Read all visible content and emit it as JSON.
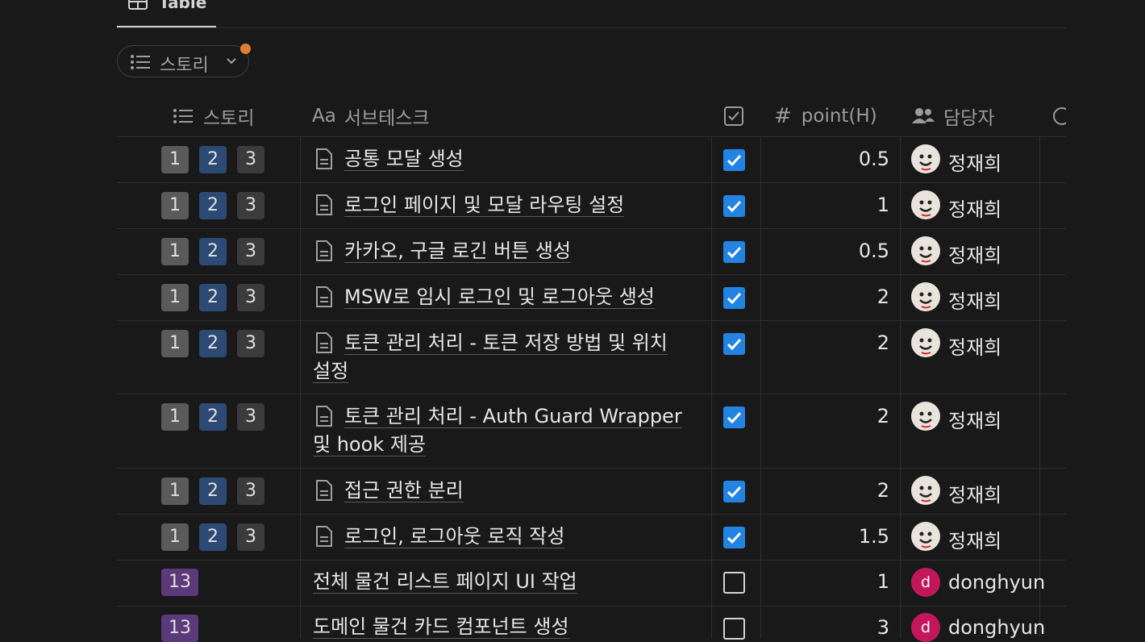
{
  "view_tab": {
    "label": "Table",
    "icon": "table-icon"
  },
  "filter": {
    "label": "스토리",
    "icon": "list-icon",
    "active_dot_color": "#e07e32"
  },
  "columns": {
    "story": "스토리",
    "subtask": "서브테스크",
    "subtask_prefix": "Aa",
    "point": "point(H)",
    "assignee": "담당자"
  },
  "badge_colors": {
    "1": "#5a5a5a",
    "2": "#2c4a73",
    "3": "#3b3b3b",
    "13": "#5b3a7a"
  },
  "rows": [
    {
      "badges": [
        "1",
        "2",
        "3"
      ],
      "task": "공통 모달 생성",
      "has_doc": true,
      "done": true,
      "point": "0.5",
      "assignee": "정재희"
    },
    {
      "badges": [
        "1",
        "2",
        "3"
      ],
      "task": "로그인 페이지 및 모달 라우팅 설정",
      "has_doc": true,
      "done": true,
      "point": "1",
      "assignee": "정재희"
    },
    {
      "badges": [
        "1",
        "2",
        "3"
      ],
      "task": "카카오, 구글 로긴 버튼 생성",
      "has_doc": true,
      "done": true,
      "point": "0.5",
      "assignee": "정재희"
    },
    {
      "badges": [
        "1",
        "2",
        "3"
      ],
      "task": "MSW로 임시 로그인 및 로그아웃 생성",
      "has_doc": true,
      "done": true,
      "point": "2",
      "assignee": "정재희"
    },
    {
      "badges": [
        "1",
        "2",
        "3"
      ],
      "task_line1": "토큰 관리 처리 - 토큰 저장 방법 및 위치",
      "task_line2": "설정",
      "has_doc": true,
      "done": true,
      "point": "2",
      "assignee": "정재희"
    },
    {
      "badges": [
        "1",
        "2",
        "3"
      ],
      "task_line1": "토큰 관리 처리 - Auth Guard Wrapper",
      "task_line2": "및 hook 제공",
      "has_doc": true,
      "done": true,
      "point": "2",
      "assignee": "정재희"
    },
    {
      "badges": [
        "1",
        "2",
        "3"
      ],
      "task": "접근 권한 분리",
      "has_doc": true,
      "done": true,
      "point": "2",
      "assignee": "정재희"
    },
    {
      "badges": [
        "1",
        "2",
        "3"
      ],
      "task": "로그인, 로그아웃 로직 작성",
      "has_doc": true,
      "done": true,
      "point": "1.5",
      "assignee": "정재희"
    },
    {
      "badges": [
        "13"
      ],
      "task": "전체 물건 리스트 페이지 UI 작업",
      "has_doc": false,
      "done": false,
      "point": "1",
      "assignee": "donghyun",
      "avatar_letter": "d"
    },
    {
      "badges": [
        "13"
      ],
      "task": "도메인 물건 카드 컴포넌트 생성",
      "has_doc": false,
      "done": false,
      "point": "3",
      "assignee": "donghyun",
      "avatar_letter": "d"
    }
  ]
}
